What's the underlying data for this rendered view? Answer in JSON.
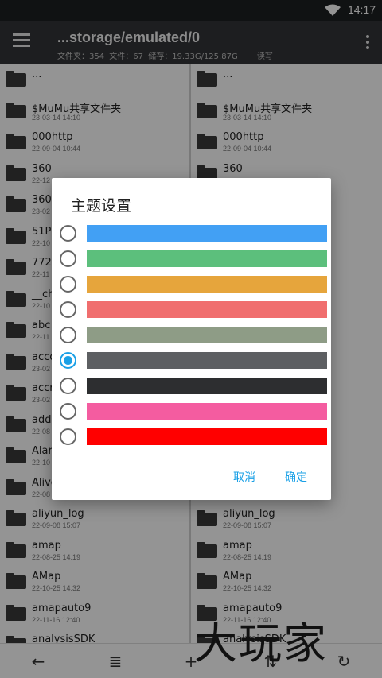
{
  "status_bar": {
    "time": "14:17"
  },
  "app_bar": {
    "path": "...storage/emulated/0",
    "info": {
      "folders": "文件夹：354",
      "files": "文件：67",
      "storage": "储存：19.33G/125.87G",
      "mode": "读写"
    }
  },
  "left_pane": [
    {
      "name": "...",
      "date": ""
    },
    {
      "name": "$MuMu共享文件夹",
      "date": "23-03-14 14:10"
    },
    {
      "name": "000http",
      "date": "22-09-04 10:44"
    },
    {
      "name": "360",
      "date": "22-12"
    },
    {
      "name": "360g",
      "date": "23-02"
    },
    {
      "name": "51PI",
      "date": "22-10"
    },
    {
      "name": "7723",
      "date": "22-11"
    },
    {
      "name": "__ch",
      "date": "22-10"
    },
    {
      "name": "abc",
      "date": "22-11"
    },
    {
      "name": "acco",
      "date": "23-02"
    },
    {
      "name": "accr",
      "date": "23-02"
    },
    {
      "name": "adda",
      "date": "22-08"
    },
    {
      "name": "Aları",
      "date": "22-10"
    },
    {
      "name": "Alivo",
      "date": "22-08"
    },
    {
      "name": "aliyun_log",
      "date": "22-09-08 15:07"
    },
    {
      "name": "amap",
      "date": "22-08-25 14:19"
    },
    {
      "name": "AMap",
      "date": "22-10-25 14:32"
    },
    {
      "name": "amapauto9",
      "date": "22-11-16 12:40"
    },
    {
      "name": "analysisSDK",
      "date": ""
    }
  ],
  "right_pane": [
    {
      "name": "...",
      "date": ""
    },
    {
      "name": "$MuMu共享文件夹",
      "date": "23-03-14 14:10"
    },
    {
      "name": "000http",
      "date": "22-09-04 10:44"
    },
    {
      "name": "360",
      "date": ""
    },
    {
      "name": "",
      "date": ""
    },
    {
      "name": "",
      "date": ""
    },
    {
      "name": "",
      "date": ""
    },
    {
      "name": "",
      "date": ""
    },
    {
      "name": "",
      "date": ""
    },
    {
      "name": "",
      "date": ""
    },
    {
      "name": "",
      "date": ""
    },
    {
      "name": "",
      "date": ""
    },
    {
      "name": "",
      "date": ""
    },
    {
      "name": "",
      "date": ""
    },
    {
      "name": "aliyun_log",
      "date": "22-09-08 15:07"
    },
    {
      "name": "amap",
      "date": "22-08-25 14:19"
    },
    {
      "name": "AMap",
      "date": "22-10-25 14:32"
    },
    {
      "name": "amapauto9",
      "date": "22-11-16 12:40"
    },
    {
      "name": "analysisSDK",
      "date": ""
    }
  ],
  "dialog": {
    "title": "主题设置",
    "themes": [
      {
        "color": "#42a0f4",
        "selected": false
      },
      {
        "color": "#5cbf7c",
        "selected": false
      },
      {
        "color": "#e6a53c",
        "selected": false
      },
      {
        "color": "#f06e6e",
        "selected": false
      },
      {
        "color": "#8e9c86",
        "selected": false
      },
      {
        "color": "#5d5f62",
        "selected": true
      },
      {
        "color": "#2d2e30",
        "selected": false
      },
      {
        "color": "#f45ca0",
        "selected": false
      },
      {
        "color": "#ff0000",
        "selected": false
      }
    ],
    "cancel_label": "取消",
    "ok_label": "确定"
  },
  "watermark": "大玩家"
}
